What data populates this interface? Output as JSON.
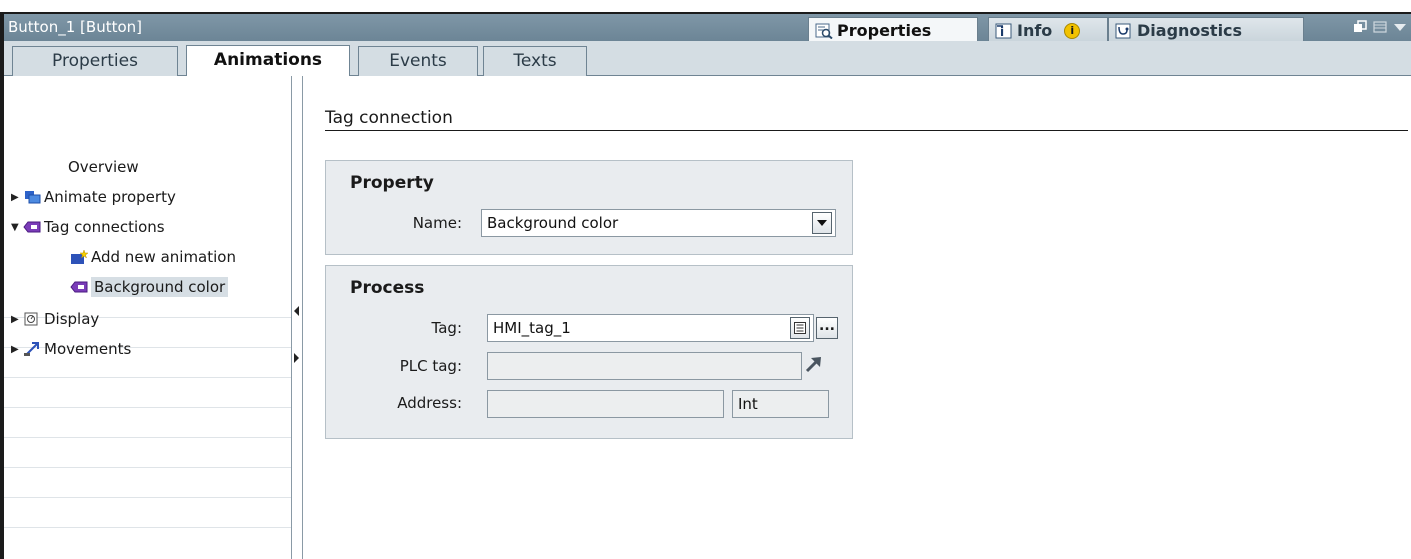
{
  "window": {
    "title": "Button_1 [Button]",
    "panel_tabs": [
      {
        "label": "Properties",
        "icon": "properties-icon",
        "active": true
      },
      {
        "label": "Info",
        "icon": "info-icon",
        "badge": "i"
      },
      {
        "label": "Diagnostics",
        "icon": "diagnostics-icon"
      }
    ]
  },
  "tabs": [
    {
      "label": "Properties",
      "active": false
    },
    {
      "label": "Animations",
      "active": true
    },
    {
      "label": "Events",
      "active": false
    },
    {
      "label": "Texts",
      "active": false
    }
  ],
  "tree": {
    "items": [
      {
        "label": "Overview",
        "icon": null,
        "expander": null
      },
      {
        "label": "Animate property",
        "icon": "animate-property-icon",
        "expander": "collapsed"
      },
      {
        "label": "Tag connections",
        "icon": "tag-connection-icon",
        "expander": "expanded"
      },
      {
        "label": "Add new animation",
        "icon": "add-animation-icon",
        "expander": null
      },
      {
        "label": "Background color",
        "icon": "tag-connection-icon",
        "expander": null,
        "selected": true
      },
      {
        "label": "Display",
        "icon": "display-icon",
        "expander": "collapsed"
      },
      {
        "label": "Movements",
        "icon": "movements-icon",
        "expander": "collapsed"
      }
    ]
  },
  "content": {
    "section_title": "Tag connection",
    "property_group": {
      "title": "Property",
      "name_label": "Name:",
      "name_value": "Background color"
    },
    "process_group": {
      "title": "Process",
      "tag_label": "Tag:",
      "tag_value": "HMI_tag_1",
      "plc_tag_label": "PLC tag:",
      "plc_tag_value": "",
      "address_label": "Address:",
      "address_value": "",
      "type_value": "Int",
      "browse_label": "..."
    }
  },
  "colors": {
    "titlebar": "#6c8596",
    "tab_strip": "#d4dde3",
    "group_bg": "#e9ecef",
    "selection": "#d6dee4"
  }
}
